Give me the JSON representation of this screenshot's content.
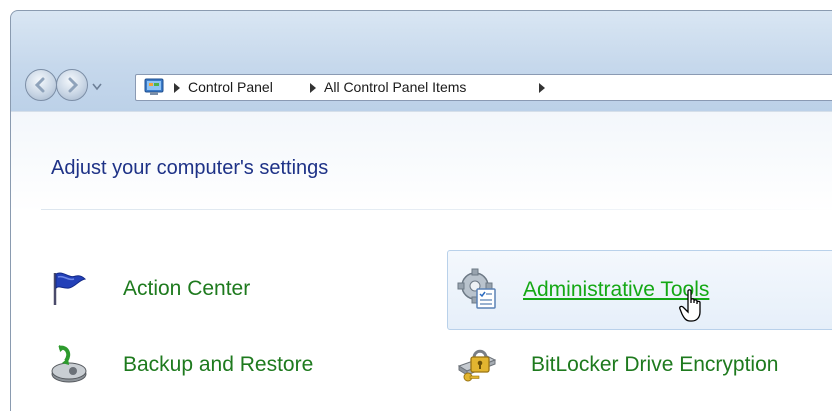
{
  "nav": {
    "back_icon": "back-arrow-icon",
    "forward_icon": "forward-arrow-icon",
    "history_icon": "chevron-down-icon"
  },
  "address": {
    "crumbs": [
      "Control Panel",
      "All Control Panel Items"
    ]
  },
  "page": {
    "title": "Adjust your computer's settings"
  },
  "items": [
    {
      "label": "Action Center",
      "icon": "flag-icon"
    },
    {
      "label": "Administrative Tools",
      "icon": "admin-tools-icon",
      "hover": true
    },
    {
      "label": "Backup and Restore",
      "icon": "backup-icon"
    },
    {
      "label": "BitLocker Drive Encryption",
      "icon": "bitlocker-icon"
    }
  ],
  "colors": {
    "title": "#1e3287",
    "link": "#1e7a1e",
    "link_hover": "#14a814",
    "hover_border": "#b9d1ea"
  }
}
